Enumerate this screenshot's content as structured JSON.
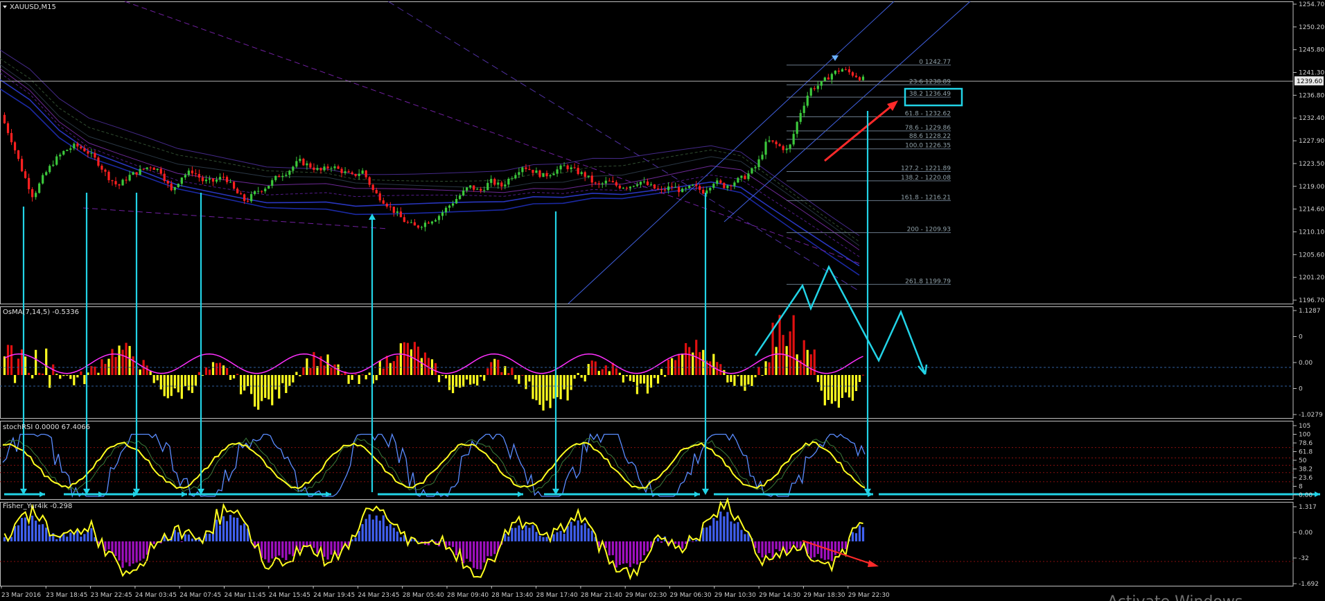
{
  "colors": {
    "background": "#000000",
    "frame": "#c0c0c0",
    "bull_candle": "#3cc83c",
    "bear_candle": "#ff2020",
    "annotation": "#22d3e6",
    "trend_red": "#ff2a2a",
    "fib": "#6a7a8a",
    "osma_red": "#e01010",
    "osma_yellow": "#ffff20",
    "osma_line": "#ff30ff",
    "stoch_blue": "#5a8cff",
    "stoch_yellow": "#ffff20",
    "fisher_blue": "#4060f0",
    "fisher_purple": "#a010c0",
    "fisher_line": "#ffff20"
  },
  "main_panel": {
    "title": "XAUUSD,M15",
    "current_price": "1239.60",
    "y_ticks": [
      "1254.70",
      "1250.20",
      "1245.80",
      "1241.30",
      "1236.80",
      "1232.40",
      "1227.90",
      "1223.50",
      "1219.00",
      "1214.60",
      "1210.10",
      "1205.60",
      "1201.20",
      "1196.70"
    ],
    "fib_levels": [
      "0 1242.77",
      "23.6 1238.89",
      "38.2 1236.49",
      "61.8 - 1232.62",
      "78.6 - 1229.86",
      "88.6 1228.22",
      "100.0 1226.35",
      "127.2 - 1221.89",
      "138.2 - 1220.08",
      "161.8 - 1216.21",
      "200 - 1209.93",
      "261.8 1199.79"
    ]
  },
  "osma_panel": {
    "title": "OsMA(7,14,5) -0.5336",
    "y_ticks": [
      "1.1287",
      "0",
      "0.00",
      "0",
      "-1.0279"
    ]
  },
  "stoch_panel": {
    "title": "stochRSI 0.0000 67.4066",
    "y_ticks": [
      "105",
      "100",
      "78.6",
      "61.8",
      "50",
      "38.2",
      "23.6",
      "8",
      "0.00"
    ]
  },
  "fisher_panel": {
    "title": "Fisher_Yur4ik -0.298",
    "y_ticks": [
      "1.317",
      "0.00",
      "-32",
      "-1.692"
    ]
  },
  "x_axis": {
    "labels": [
      "23 Mar 2016",
      "23 Mar 18:45",
      "23 Mar 22:45",
      "24 Mar 03:45",
      "24 Mar 07:45",
      "24 Mar 11:45",
      "24 Mar 15:45",
      "24 Mar 19:45",
      "24 Mar 23:45",
      "28 Mar 05:40",
      "28 Mar 09:40",
      "28 Mar 13:40",
      "28 Mar 17:40",
      "28 Mar 21:40",
      "29 Mar 02:30",
      "29 Mar 06:30",
      "29 Mar 10:30",
      "29 Mar 14:30",
      "29 Mar 18:30",
      "29 Mar 22:30"
    ]
  },
  "watermark": "Activate Windows",
  "chart_data": [
    {
      "type": "candlestick",
      "title": "XAUUSD,M15",
      "ylim": [
        1196.7,
        1254.7
      ],
      "close_path": [
        1233,
        1228,
        1222,
        1217,
        1221,
        1224,
        1226,
        1227,
        1226,
        1224,
        1221,
        1219,
        1221,
        1222,
        1223,
        1222,
        1218,
        1221,
        1222,
        1220,
        1220,
        1221,
        1218,
        1216,
        1218,
        1219,
        1221,
        1222,
        1224,
        1223,
        1222,
        1223,
        1222,
        1221,
        1222,
        1218,
        1216,
        1214,
        1212,
        1211,
        1212,
        1213,
        1215,
        1217,
        1219,
        1218,
        1220,
        1219,
        1221,
        1223,
        1222,
        1221,
        1222,
        1223,
        1222,
        1221,
        1219,
        1220,
        1219,
        1219,
        1220,
        1219,
        1218,
        1219,
        1218,
        1219,
        1218,
        1220,
        1219,
        1220,
        1221,
        1223,
        1228,
        1227,
        1226,
        1233,
        1238,
        1239,
        1241,
        1242,
        1241,
        1240
      ],
      "fib_retracement": [
        [
          0,
          1242.77
        ],
        [
          23.6,
          1238.89
        ],
        [
          38.2,
          1236.49
        ],
        [
          61.8,
          1232.62
        ],
        [
          78.6,
          1229.86
        ],
        [
          88.6,
          1228.22
        ],
        [
          100.0,
          1226.35
        ],
        [
          127.2,
          1221.89
        ],
        [
          138.2,
          1220.08
        ],
        [
          161.8,
          1216.21
        ],
        [
          200,
          1209.93
        ],
        [
          261.8,
          1199.79
        ]
      ]
    },
    {
      "type": "bar",
      "title": "OsMA(7,14,5)",
      "last_value": -0.5336,
      "ylim": [
        -1.0279,
        1.1287
      ]
    },
    {
      "type": "line",
      "title": "stochRSI",
      "last_values": [
        0.0,
        67.4066
      ],
      "ylim": [
        0,
        105
      ],
      "levels": [
        23.6,
        38.2,
        50,
        61.8,
        78.6
      ]
    },
    {
      "type": "bar",
      "title": "Fisher_Yur4ik",
      "last_value": -0.298,
      "ylim": [
        -1.692,
        1.317
      ]
    }
  ]
}
